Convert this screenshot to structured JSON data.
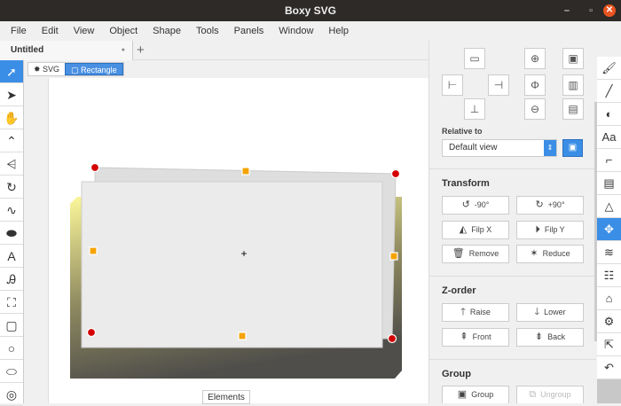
{
  "window": {
    "title": "Boxy SVG",
    "minimize": "–",
    "maximize": "▫",
    "close": "✕"
  },
  "menu": [
    "File",
    "Edit",
    "View",
    "Object",
    "Shape",
    "Tools",
    "Panels",
    "Window",
    "Help"
  ],
  "tabs": {
    "active": "Untitled",
    "modified_dot": "●",
    "add": "+"
  },
  "left_tools": [
    {
      "name": "selection-tool",
      "glyph": "➚"
    },
    {
      "name": "edit-tool",
      "glyph": "➤"
    },
    {
      "name": "pan-tool",
      "glyph": "✋"
    },
    {
      "name": "path-node-tool",
      "glyph": "⌃"
    },
    {
      "name": "multi-node-tool",
      "glyph": "⩤"
    },
    {
      "name": "rotate-tool",
      "glyph": "↻"
    },
    {
      "name": "freehand-tool",
      "glyph": "∿"
    },
    {
      "name": "blob-tool",
      "glyph": "⬬"
    },
    {
      "name": "text-tool",
      "glyph": "A"
    },
    {
      "name": "text-path-tool",
      "glyph": "Ꭿ"
    },
    {
      "name": "crop-tool",
      "glyph": "⛶"
    },
    {
      "name": "rectangle-tool",
      "glyph": "▢"
    },
    {
      "name": "circle-tool",
      "glyph": "○"
    },
    {
      "name": "ellipse-tool",
      "glyph": "⬭"
    },
    {
      "name": "ring-tool",
      "glyph": "◎"
    }
  ],
  "breadcrumb": {
    "root": "SVG",
    "selected": "Rectangle"
  },
  "canvas": {
    "elements_button": "Elements"
  },
  "panel": {
    "relative_to_label": "Relative to",
    "relative_to_value": "Default view",
    "transform": {
      "title": "Transform",
      "rotate_left": "-90°",
      "rotate_right": "+90°",
      "flip_x": "Filp X",
      "flip_y": "Filp Y",
      "remove": "Remove",
      "reduce": "Reduce"
    },
    "zorder": {
      "title": "Z-order",
      "raise": "Raise",
      "lower": "Lower",
      "front": "Front",
      "back": "Back"
    },
    "group": {
      "title": "Group",
      "group": "Group",
      "ungroup": "Ungroup"
    }
  },
  "right_tools": [
    {
      "name": "fill-panel",
      "glyph": "🖌"
    },
    {
      "name": "stroke-panel",
      "glyph": "╱"
    },
    {
      "name": "compositing-panel",
      "glyph": "◐"
    },
    {
      "name": "typography-panel",
      "glyph": "Aa"
    },
    {
      "name": "geometry-panel",
      "glyph": "⌐"
    },
    {
      "name": "comments-panel",
      "glyph": "▤"
    },
    {
      "name": "shapes-panel",
      "glyph": "△"
    },
    {
      "name": "arrange-panel",
      "glyph": "✥"
    },
    {
      "name": "layers-panel",
      "glyph": "≋"
    },
    {
      "name": "elements-panel",
      "glyph": "☷"
    },
    {
      "name": "library-panel",
      "glyph": "⌂"
    },
    {
      "name": "defs-panel",
      "glyph": "⚙"
    },
    {
      "name": "export-panel",
      "glyph": "⇱"
    },
    {
      "name": "history-panel",
      "glyph": "↶"
    }
  ],
  "colors": {
    "accent": "#3b8ee6",
    "handle_red": "#d40000",
    "handle_orange": "#f5a300"
  }
}
